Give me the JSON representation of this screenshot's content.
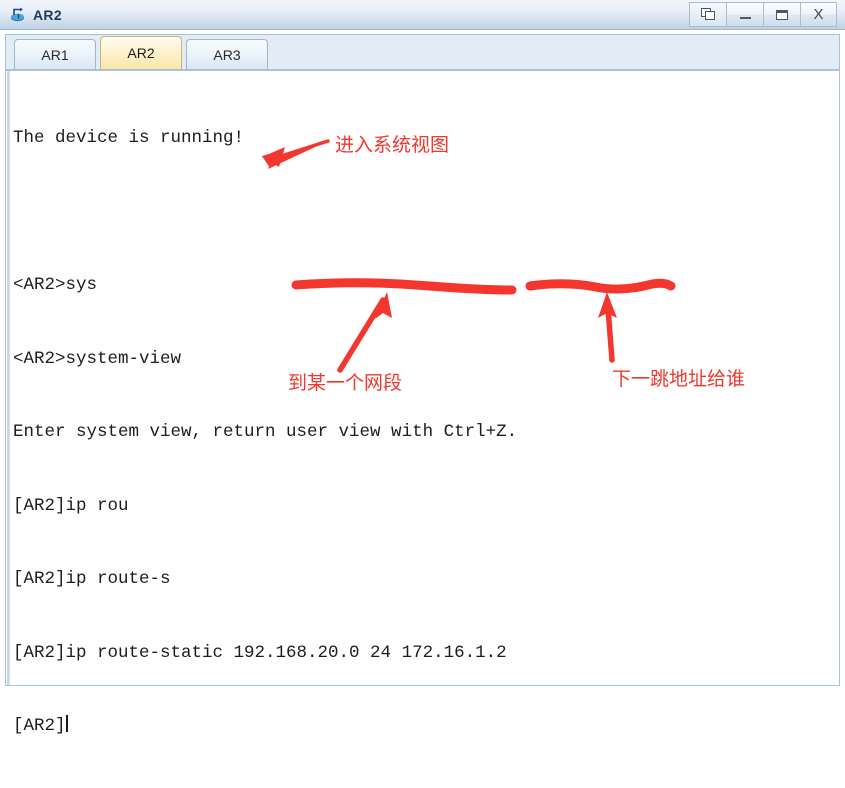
{
  "window": {
    "title": "AR2",
    "icon": "router-icon",
    "buttons": [
      {
        "name": "restore-down-button",
        "icon": "restore-icon",
        "label": ""
      },
      {
        "name": "minimize-button",
        "icon": "minimize-icon",
        "label": ""
      },
      {
        "name": "maximize-button",
        "icon": "maximize-icon",
        "label": ""
      },
      {
        "name": "close-button",
        "icon": "close-icon",
        "label": "X"
      }
    ]
  },
  "tabs": [
    {
      "label": "AR1",
      "active": false
    },
    {
      "label": "AR2",
      "active": true
    },
    {
      "label": "AR3",
      "active": false
    }
  ],
  "terminal": {
    "lines": [
      "The device is running!",
      "",
      "<AR2>sys",
      "<AR2>system-view",
      "Enter system view, return user view with Ctrl+Z.",
      "[AR2]ip rou",
      "[AR2]ip route-s",
      "[AR2]ip route-static 192.168.20.0 24 172.16.1.2",
      "[AR2]"
    ],
    "prompt_cursor": true
  },
  "annotations": {
    "color": "#f4372e",
    "enter_system_view": "进入系统视图",
    "to_network_segment": "到某一个网段",
    "next_hop_address": "下一跳地址给谁"
  },
  "colors": {
    "annotation_red": "#f4372e",
    "titlebar_top": "#f2f6fb",
    "titlebar_bottom": "#bcd2e4",
    "tabstrip_bg": "#e2ecf7",
    "active_tab": "#fae7a8",
    "terminal_bg": "#ffffff",
    "terminal_text": "#1d1d1d"
  }
}
